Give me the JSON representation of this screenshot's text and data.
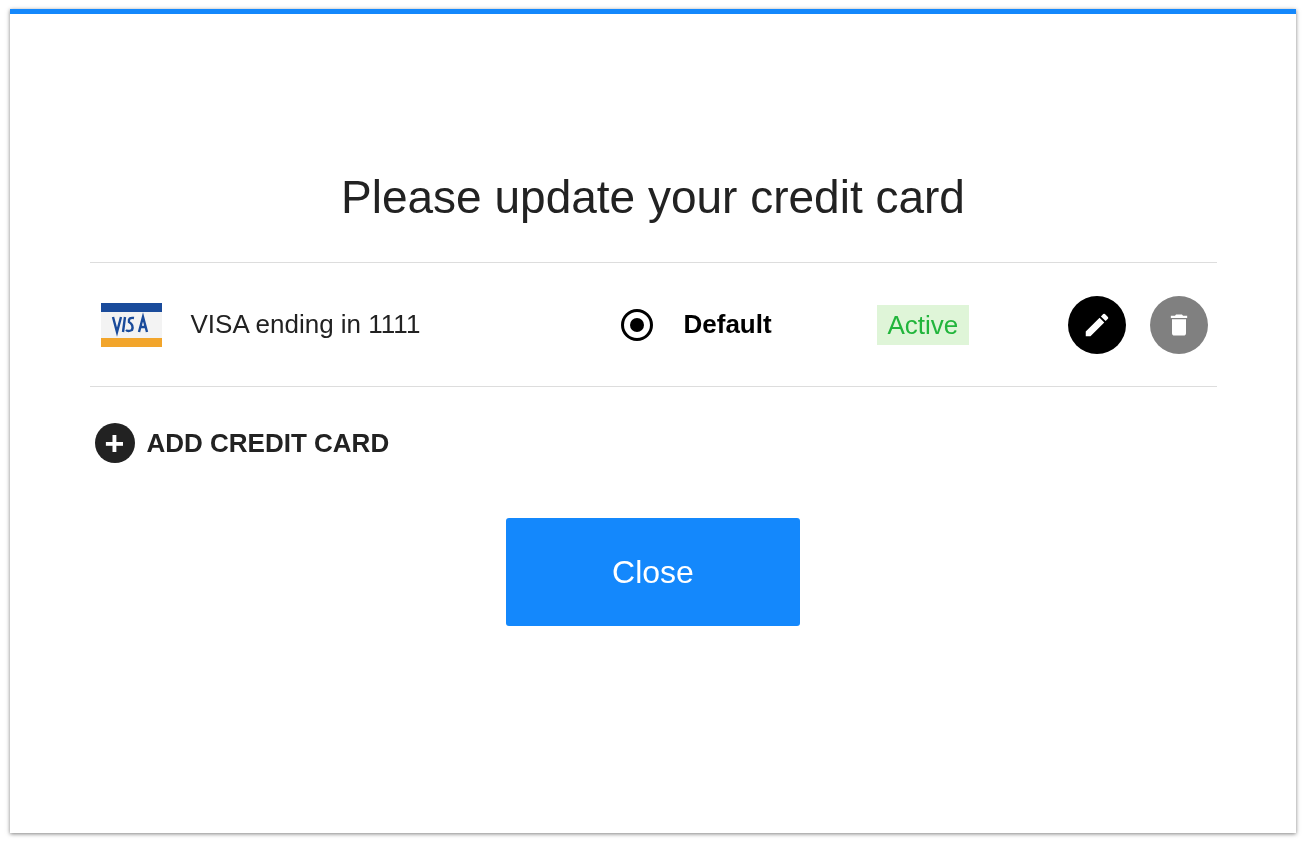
{
  "dialog": {
    "title": "Please update your credit card"
  },
  "cards": [
    {
      "label": "VISA ending in 1111",
      "default_label": "Default",
      "selected": true,
      "status": "Active"
    }
  ],
  "add_button": {
    "label": "ADD CREDIT CARD",
    "icon": "+"
  },
  "close_button": {
    "label": "Close"
  }
}
